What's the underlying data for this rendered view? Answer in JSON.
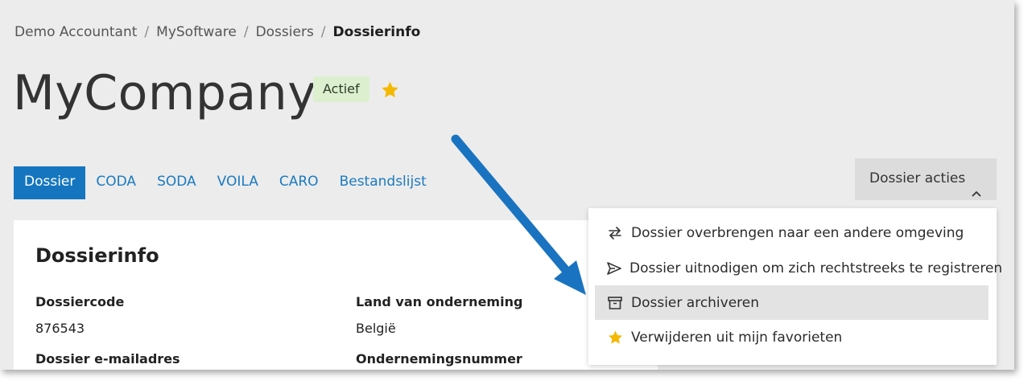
{
  "breadcrumb": {
    "items": [
      "Demo Accountant",
      "MySoftware",
      "Dossiers"
    ],
    "separator": "/",
    "current": "Dossierinfo"
  },
  "page": {
    "title": "MyCompany",
    "status_badge": "Actief",
    "favorite_icon": "star-icon"
  },
  "tabs": [
    {
      "label": "Dossier",
      "active": true
    },
    {
      "label": "CODA"
    },
    {
      "label": "SODA"
    },
    {
      "label": "VOILA"
    },
    {
      "label": "CARO"
    },
    {
      "label": "Bestandslijst"
    }
  ],
  "actions": {
    "label": "Dossier acties",
    "icon": "chevron-up-icon"
  },
  "menu": {
    "items": [
      {
        "label": "Dossier overbrengen naar een andere omgeving",
        "icon": "transfer-icon"
      },
      {
        "label": "Dossier uitnodigen om zich rechtstreeks te registreren",
        "icon": "send-icon"
      },
      {
        "label": "Dossier archiveren",
        "icon": "archive-icon",
        "highlighted": true
      },
      {
        "label": "Verwijderen uit mijn favorieten",
        "icon": "star-icon"
      }
    ]
  },
  "card": {
    "title": "Dossierinfo",
    "fields": {
      "code_label": "Dossiercode",
      "code_value": "876543",
      "email_label": "Dossier e-mailadres",
      "country_label": "Land van onderneming",
      "country_value": "België",
      "enterprise_label": "Ondernemingsnummer"
    }
  },
  "colors": {
    "accent": "#1576bf",
    "badge_bg": "#dcf0cf",
    "star": "#f5b800",
    "annotation_arrow": "#1a73c0"
  }
}
